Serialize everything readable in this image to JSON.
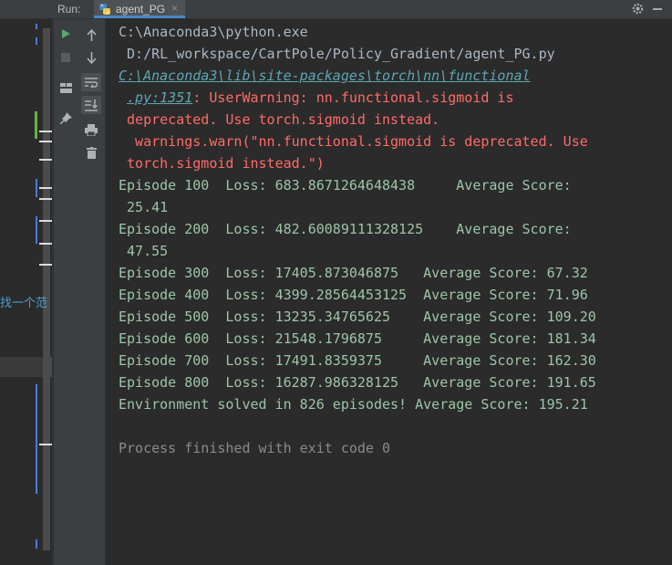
{
  "run_bar": {
    "run_label": "Run:",
    "tab_title": "agent_PG",
    "close_glyph": "×"
  },
  "left_editor": {
    "cjk_fragment": "找一个范"
  },
  "console": {
    "cmd_line_1": "C:\\Anaconda3\\python.exe",
    "cmd_line_2": " D:/RL_workspace/CartPole/Policy_Gradient/agent_PG.py",
    "warn_link_1": "C:\\Anaconda3\\lib\\site-packages\\torch\\nn\\functional",
    "warn_link_2": ".py:1351",
    "warn_text_1": ": UserWarning: nn.functional.sigmoid is",
    "warn_text_2": " deprecated. Use torch.sigmoid instead.",
    "warn_text_3": "  warnings.warn(\"nn.functional.sigmoid is deprecated. Use",
    "warn_text_4": " torch.sigmoid instead.\")",
    "episodes": [
      {
        "line": "Episode 100  Loss: 683.8671264648438     Average Score:",
        "wrap": " 25.41"
      },
      {
        "line": "Episode 200  Loss: 482.60089111328125    Average Score:",
        "wrap": " 47.55"
      },
      {
        "line": "Episode 300  Loss: 17405.873046875   Average Score: 67.32"
      },
      {
        "line": "Episode 400  Loss: 4399.28564453125  Average Score: 71.96"
      },
      {
        "line": "Episode 500  Loss: 13235.34765625    Average Score: 109.20"
      },
      {
        "line": "Episode 600  Loss: 21548.1796875     Average Score: 181.34"
      },
      {
        "line": "Episode 700  Loss: 17491.8359375     Average Score: 162.30"
      },
      {
        "line": "Episode 800  Loss: 16287.986328125   Average Score: 191.65"
      }
    ],
    "solved_line": "Environment solved in 826 episodes! Average Score: 195.21",
    "exit_line": "Process finished with exit code 0"
  },
  "colors": {
    "background": "#2b2b2b",
    "output_text": "#9cc5a7",
    "error_text": "#ff6b68",
    "link_text": "#5ea6b3",
    "run_green": "#59a869"
  },
  "icons": [
    "python-icon",
    "gear-icon",
    "minimize-icon",
    "rerun-icon",
    "stop-icon",
    "layout-icon",
    "pin-icon",
    "up-arrow-icon",
    "down-arrow-icon",
    "soft-wrap-icon",
    "scroll-to-end-icon",
    "print-icon",
    "trash-icon"
  ]
}
